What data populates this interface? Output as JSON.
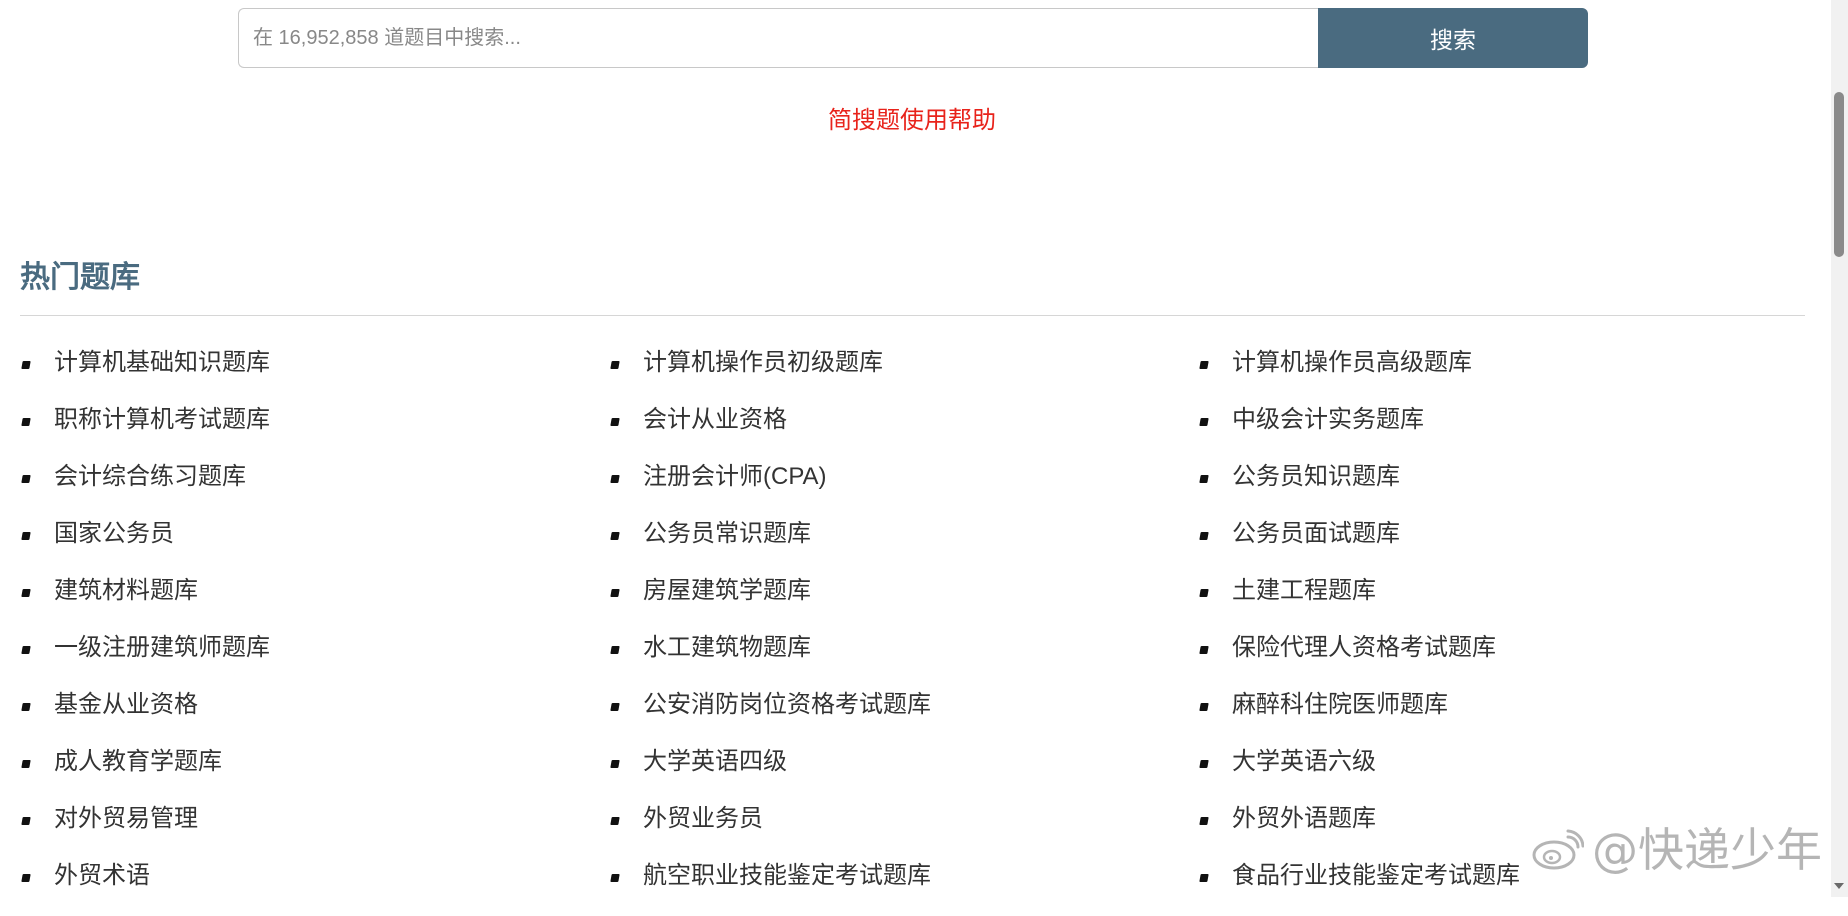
{
  "search": {
    "placeholder": "在 16,952,858 道题目中搜索...",
    "button_label": "搜索"
  },
  "help_link": "简搜题使用帮助",
  "section_title": "热门题库",
  "banks": [
    "计算机基础知识题库",
    "计算机操作员初级题库",
    "计算机操作员高级题库",
    "职称计算机考试题库",
    "会计从业资格",
    "中级会计实务题库",
    "会计综合练习题库",
    "注册会计师(CPA)",
    "公务员知识题库",
    "国家公务员",
    "公务员常识题库",
    "公务员面试题库",
    "建筑材料题库",
    "房屋建筑学题库",
    "土建工程题库",
    "一级注册建筑师题库",
    "水工建筑物题库",
    "保险代理人资格考试题库",
    "基金从业资格",
    "公安消防岗位资格考试题库",
    "麻醉科住院医师题库",
    "成人教育学题库",
    "大学英语四级",
    "大学英语六级",
    "对外贸易管理",
    "外贸业务员",
    "外贸外语题库",
    "外贸术语",
    "航空职业技能鉴定考试题库",
    "食品行业技能鉴定考试题库"
  ],
  "watermark": {
    "icon": "weibo-icon",
    "text": "@快递少年"
  }
}
